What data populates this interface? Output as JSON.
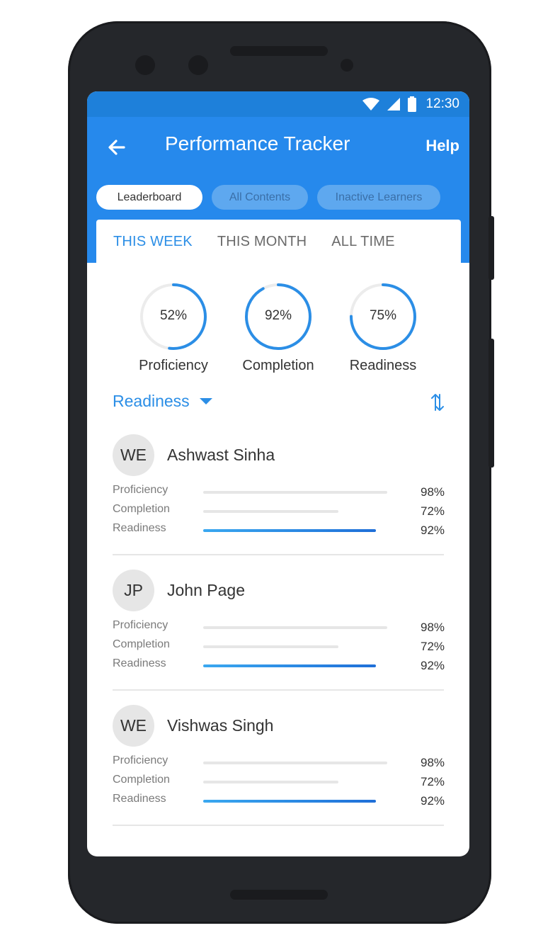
{
  "status": {
    "time": "12:30"
  },
  "header": {
    "title": "Performance Tracker",
    "help_label": "Help"
  },
  "tabs": [
    "Leaderboard",
    "All Contents",
    "Inactive Learners"
  ],
  "periods": [
    "THIS WEEK",
    "THIS MONTH",
    "ALL TIME"
  ],
  "summary": [
    {
      "label": "Proficiency",
      "value": "52%",
      "fraction": 0.52
    },
    {
      "label": "Completion",
      "value": "92%",
      "fraction": 0.92
    },
    {
      "label": "Readiness",
      "value": "75%",
      "fraction": 0.75
    }
  ],
  "sort": {
    "label": "Readiness"
  },
  "learners": [
    {
      "initials": "WE",
      "name": "Ashwast Sinha",
      "metrics": [
        {
          "label": "Proficiency",
          "value": "98%",
          "fraction": 0.98
        },
        {
          "label": "Completion",
          "value": "72%",
          "fraction": 0.72
        },
        {
          "label": "Readiness",
          "value": "92%",
          "fraction": 0.92
        }
      ]
    },
    {
      "initials": "JP",
      "name": "John Page",
      "metrics": [
        {
          "label": "Proficiency",
          "value": "98%",
          "fraction": 0.98
        },
        {
          "label": "Completion",
          "value": "72%",
          "fraction": 0.72
        },
        {
          "label": "Readiness",
          "value": "92%",
          "fraction": 0.92
        }
      ]
    },
    {
      "initials": "WE",
      "name": "Vishwas Singh",
      "metrics": [
        {
          "label": "Proficiency",
          "value": "98%",
          "fraction": 0.98
        },
        {
          "label": "Completion",
          "value": "72%",
          "fraction": 0.72
        },
        {
          "label": "Readiness",
          "value": "92%",
          "fraction": 0.92
        }
      ]
    }
  ],
  "colors": {
    "primary": "#2689ec",
    "statusbar": "#1e80da",
    "accent": "#2b8ee6"
  }
}
